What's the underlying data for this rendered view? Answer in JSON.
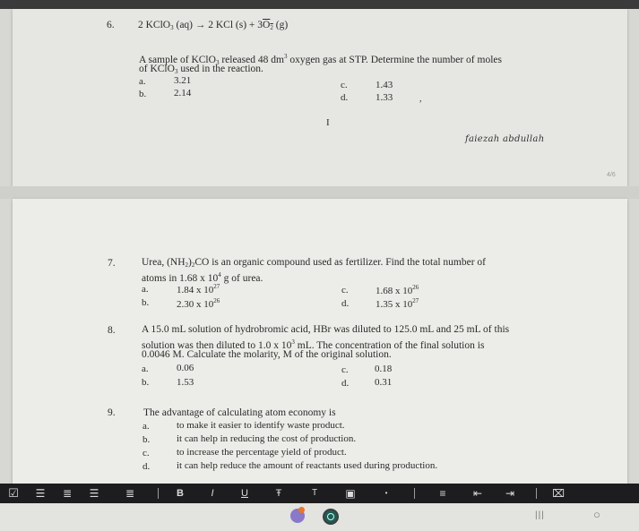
{
  "q6": {
    "number": "6.",
    "equation": [
      "2 KClO",
      "3",
      " (aq)  →  2 KCl (s)  +  3",
      "O",
      "2",
      " (g)"
    ],
    "text_line1": [
      "A sample of KClO",
      "3",
      " released 48 dm",
      "3",
      " oxygen gas at STP. Determine the number of moles"
    ],
    "text_line2": [
      "of KClO",
      "3",
      " used in the reaction."
    ],
    "options": [
      {
        "letter": "a.",
        "value": "3.21"
      },
      {
        "letter": "b.",
        "value": "2.14"
      },
      {
        "letter": "c.",
        "value": "1.43"
      },
      {
        "letter": "d.",
        "value": "1.33"
      }
    ]
  },
  "signature": "faiezah abdullah",
  "page_number": "4/6",
  "q7": {
    "number": "7.",
    "text_line1": [
      "Urea, (NH",
      "2",
      ")",
      "2",
      "CO is an organic compound used as fertilizer. Find the total number of"
    ],
    "text_line2": [
      "atoms in 1.68 x 10",
      "4",
      " g of urea."
    ],
    "options": [
      {
        "letter": "a.",
        "value": "1.84 x 10",
        "exp": "27"
      },
      {
        "letter": "b.",
        "value": "2.30 x 10",
        "exp": "26"
      },
      {
        "letter": "c.",
        "value": "1.68 x 10",
        "exp": "26"
      },
      {
        "letter": "d.",
        "value": "1.35 x 10",
        "exp": "27"
      }
    ]
  },
  "q8": {
    "number": "8.",
    "text_line1": "A 15.0 mL solution of hydrobromic acid, HBr was diluted to 125.0 mL and 25 mL of this",
    "text_line2": [
      "solution was then diluted to 1.0 x 10",
      "3",
      " mL. The concentration of the final solution is"
    ],
    "text_line3": "0.0046 M. Calculate the molarity, M of the original solution.",
    "options": [
      {
        "letter": "a.",
        "value": "0.06"
      },
      {
        "letter": "b.",
        "value": "1.53"
      },
      {
        "letter": "c.",
        "value": "0.18"
      },
      {
        "letter": "d.",
        "value": "0.31"
      }
    ]
  },
  "q9": {
    "number": "9.",
    "text": "The advantage of calculating atom economy is",
    "options": [
      {
        "letter": "a.",
        "value": "to make it easier to identify waste product."
      },
      {
        "letter": "b.",
        "value": "it can help in reducing the cost of production."
      },
      {
        "letter": "c.",
        "value": "to increase the percentage yield of product."
      },
      {
        "letter": "d.",
        "value": "it can help reduce the amount of reactants used during production."
      }
    ]
  },
  "toolbar": {
    "checkbox_icon": "☑",
    "bullets_icon": "☰",
    "numbered_icon": "≣",
    "bold": "B",
    "italic": "I",
    "underline": "U",
    "strike": "Ŧ",
    "text_size": "T",
    "color_icon": "▣",
    "more": "•",
    "align": "≡",
    "indent_left": "⇤",
    "indent_right": "⇥",
    "format": "⌧"
  },
  "navbar": {
    "recents": "|||",
    "home": "○"
  },
  "colors": {
    "page": "#e9e9e6",
    "toolbar": "#1d1d1f",
    "navbar": "#e3e3e0"
  }
}
